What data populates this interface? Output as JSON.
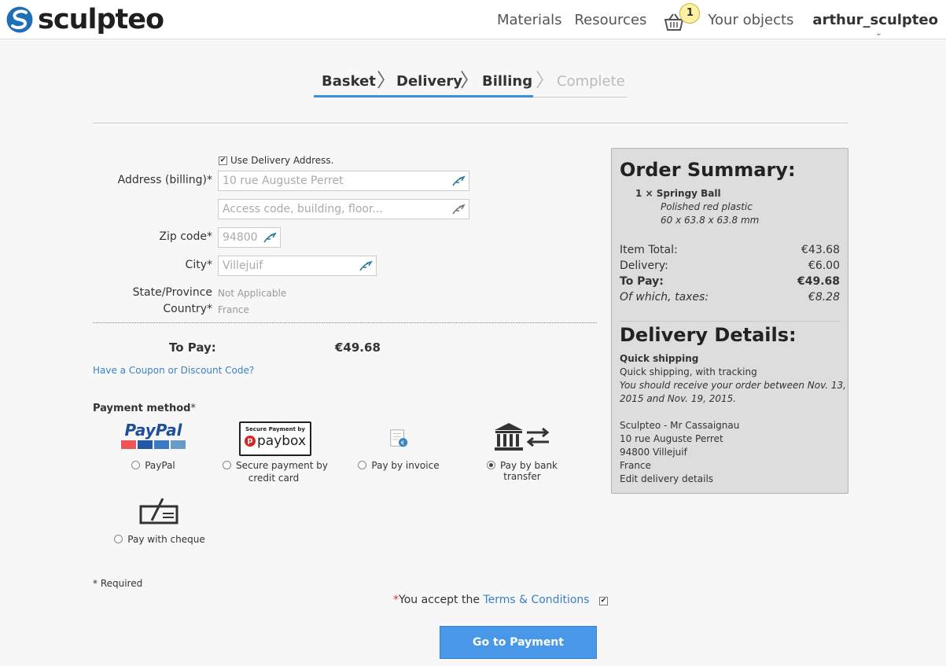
{
  "header": {
    "logo_text": "sculpteo",
    "nav": [
      "Materials",
      "Resources"
    ],
    "basket_count": "1",
    "your_objects": "Your objects",
    "user": "arthur_sculpteo"
  },
  "steps": [
    "Basket",
    "Delivery",
    "Billing",
    "Complete"
  ],
  "form": {
    "use_delivery": "Use Delivery Address.",
    "address_label": "Address (billing)*",
    "address_placeholder": "10 rue Auguste Perret",
    "address2_placeholder": "Access code, building, floor...",
    "zip_label": "Zip code*",
    "zip_placeholder": "94800",
    "city_label": "City*",
    "city_placeholder": "Villejuif",
    "state_label": "State/Province",
    "state_value": "Not Applicable",
    "country_label": "Country*",
    "country_value": "France"
  },
  "topay": {
    "label": "To Pay:",
    "value": "€49.68"
  },
  "coupon": "Have a Coupon or Discount Code?",
  "payment": {
    "title": "Payment method",
    "title_star": "*",
    "paypal_logo": "PayPal",
    "paybox_top": "Secure Payment by",
    "paybox_name": "paybox",
    "methods": {
      "paypal": "PayPal",
      "card_line1": "Secure payment by",
      "card_line2": "credit card",
      "invoice": "Pay by invoice",
      "bank": "Pay by bank transfer",
      "cheque": "Pay with cheque"
    },
    "selected": "bank"
  },
  "required": "* Required",
  "terms": {
    "star": "*",
    "text": "You accept the ",
    "link": "Terms & Conditions"
  },
  "pay_button": "Go to Payment",
  "summary": {
    "title": "Order Summary:",
    "item_name": "1 × Springy Ball",
    "item_material": "Polished red plastic",
    "item_size": "60 x 63.8 x 63.8 mm",
    "item_total_label": "Item Total:",
    "item_total": "€43.68",
    "delivery_label": "Delivery:",
    "delivery": "€6.00",
    "topay_label": "To Pay:",
    "topay": "€49.68",
    "taxes_label": "Of which, taxes:",
    "taxes": "€8.28",
    "delivery_title": "Delivery Details:",
    "shipping_name": "Quick shipping",
    "shipping_desc": "Quick shipping, with tracking",
    "shipping_eta_1": "You should receive your order between Nov. 13,",
    "shipping_eta_2": "2015 and Nov. 19, 2015.",
    "addr_1": "Sculpteo - Mr Cassaignau",
    "addr_2": "10 rue Auguste Perret",
    "addr_3": "94800 Villejuif",
    "addr_4": "France",
    "edit_link": "Edit delivery details"
  },
  "colors": {
    "accent": "#3b8ee3",
    "button": "#4897e8",
    "link": "#3a82c4",
    "panel": "#dddddd"
  }
}
